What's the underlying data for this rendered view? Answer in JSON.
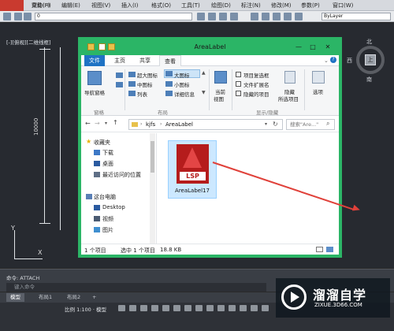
{
  "menubar": {
    "items": [
      "文件(F)",
      "编辑(E)",
      "视图(V)",
      "插入(I)",
      "格式(O)",
      "工具(T)",
      "绘图(D)",
      "标注(N)",
      "修改(M)",
      "参数(P)",
      "窗口(W)"
    ],
    "help": "帮助(H)"
  },
  "toolbar": {
    "layer_value": "0",
    "bylayer": "ByLayer"
  },
  "canvas": {
    "view_label": "[-][俯视][二维线框]",
    "dimension": "10000"
  },
  "compass": {
    "north": "北",
    "south": "南",
    "west": "西",
    "cube": "上"
  },
  "explorer": {
    "title": "AreaLabel",
    "tabs": [
      "文件",
      "主页",
      "共享",
      "查看"
    ],
    "ribbon": {
      "nav_pane": "导航窗格",
      "panes_group": "窗格",
      "layouts": [
        "超大图标",
        "大图标",
        "中图标",
        "小图标",
        "列表",
        "详细信息"
      ],
      "layout_group": "布局",
      "current_view": "当前",
      "current_view2": "视图",
      "show_options": [
        "项目复选框",
        "文件扩展名",
        "隐藏的项目"
      ],
      "hide_selected": "隐藏",
      "hide_selected2": "所选项目",
      "show_group": "显示/隐藏",
      "options": "选项"
    },
    "address": {
      "path1": "kjfs",
      "path2": "AreaLabel",
      "search_placeholder": "搜索\"Are...\""
    },
    "nav": {
      "favorites": "收藏夹",
      "items": [
        "下载",
        "桌面",
        "最近访问的位置"
      ],
      "this_pc": "这台电脑",
      "pc_items": [
        "Desktop",
        "视频",
        "图片"
      ]
    },
    "file": {
      "name": "AreaLabel17",
      "ext_tag": "LSP"
    },
    "status": {
      "count": "1 个项目",
      "selected": "选中 1 个项目",
      "size": "18.8 KB"
    }
  },
  "command": {
    "history": "命令: ATTACH",
    "prompt": "键入命令"
  },
  "layout_tabs": [
    "模型",
    "布局1",
    "布局2",
    "+"
  ],
  "bottom": {
    "scale": "比例 1:100",
    "model": "模型"
  },
  "watermark": {
    "brand": "溜溜自学",
    "url": "ZIXUE.3D66.COM"
  },
  "colors": {
    "explorer_frame": "#2bb566",
    "file_tab": "#1f73c4",
    "cad_bg": "#272a30"
  }
}
